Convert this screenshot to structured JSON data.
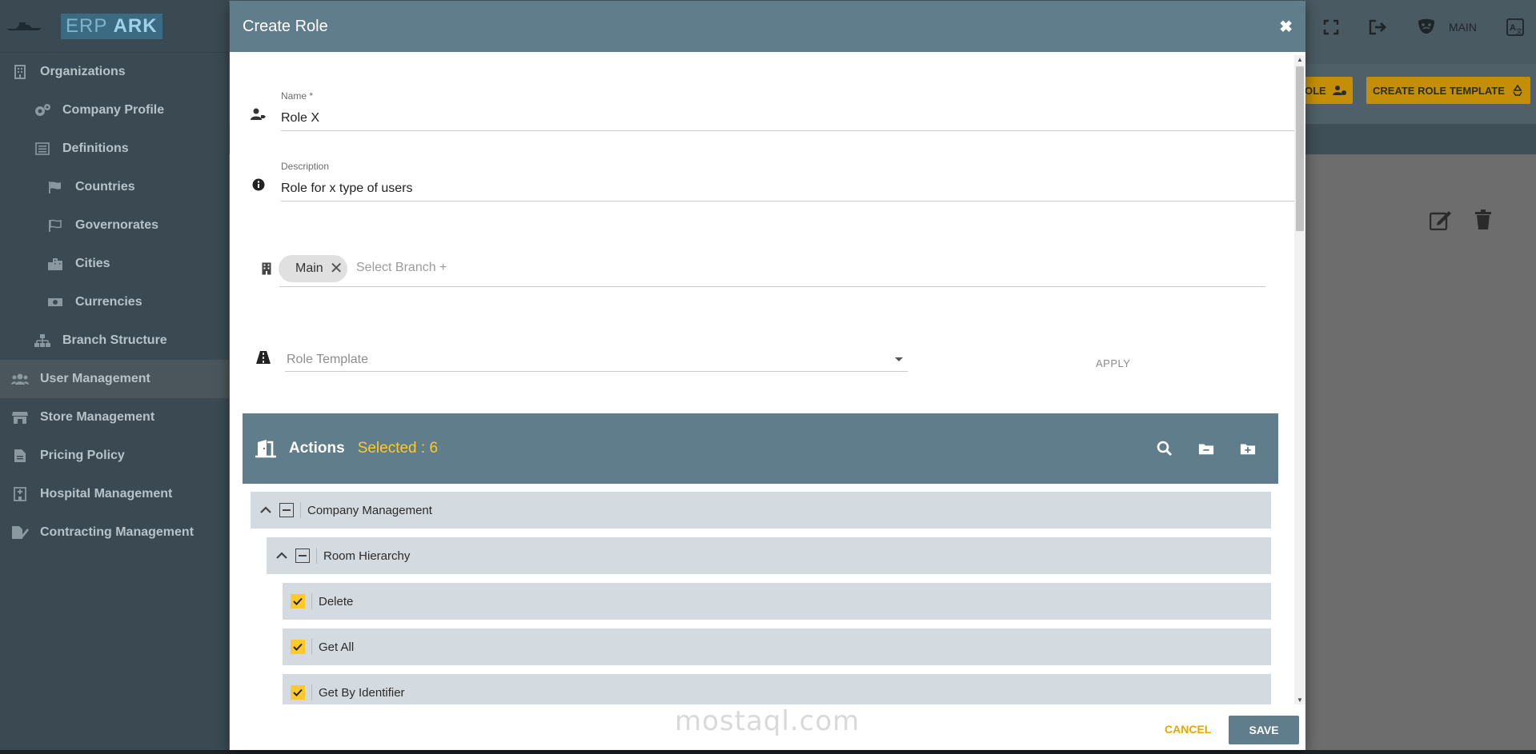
{
  "app": {
    "logo_text_1": "ERP",
    "logo_text_2": "ARK"
  },
  "sidebar": {
    "items": [
      {
        "label": "Organizations",
        "icon": "building-icon",
        "level": 0
      },
      {
        "label": "Company Profile",
        "icon": "gears-icon",
        "level": 1
      },
      {
        "label": "Definitions",
        "icon": "list-icon",
        "level": 1
      },
      {
        "label": "Countries",
        "icon": "flag-icon",
        "level": 2
      },
      {
        "label": "Governorates",
        "icon": "flag-outline-icon",
        "level": 2
      },
      {
        "label": "Cities",
        "icon": "city-icon",
        "level": 2
      },
      {
        "label": "Currencies",
        "icon": "money-icon",
        "level": 2
      },
      {
        "label": "Branch Structure",
        "icon": "sitemap-icon",
        "level": 1
      },
      {
        "label": "User Management",
        "icon": "users-icon",
        "level": 0,
        "active": true
      },
      {
        "label": "Store Management",
        "icon": "store-icon",
        "level": 0
      },
      {
        "label": "Pricing Policy",
        "icon": "file-invoice-icon",
        "level": 0
      },
      {
        "label": "Hospital Management",
        "icon": "hospital-icon",
        "level": 0
      },
      {
        "label": "Contracting Management",
        "icon": "file-signature-icon",
        "level": 0
      }
    ]
  },
  "topbar": {
    "branch_label": "MAIN"
  },
  "background_buttons": {
    "create_role_partial": "OLE",
    "create_role_template": "CREATE ROLE TEMPLATE"
  },
  "modal": {
    "title": "Create Role",
    "name_label": "Name *",
    "name_value": "Role X",
    "description_label": "Description",
    "description_value": "Role for x type of users",
    "branch_chip": "Main",
    "branch_placeholder": "Select Branch +",
    "role_template_placeholder": "Role Template",
    "apply_label": "APPLY",
    "actions_title": "Actions",
    "actions_selected": "Selected : 6",
    "tree": [
      {
        "label": "Company Management",
        "type": "group",
        "level": 0
      },
      {
        "label": "Room Hierarchy",
        "type": "group",
        "level": 1
      },
      {
        "label": "Delete",
        "type": "item",
        "checked": true
      },
      {
        "label": "Get All",
        "type": "item",
        "checked": true
      },
      {
        "label": "Get By Identifier",
        "type": "item",
        "checked": true
      }
    ],
    "cancel_label": "CANCEL",
    "save_label": "SAVE"
  },
  "watermark": "mostaql.com",
  "colors": {
    "modal_header": "#607d8b",
    "accent_yellow": "#ffca28",
    "sidebar_bg": "#3b4a52",
    "tree_row_bg": "#d3dbe0"
  }
}
